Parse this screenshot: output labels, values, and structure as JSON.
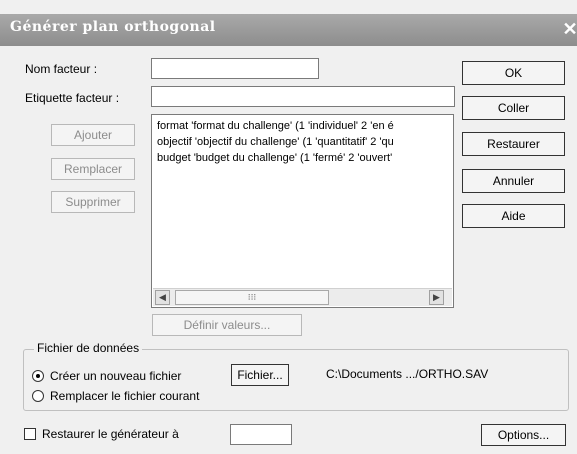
{
  "window": {
    "title": "Générer plan orthogonal",
    "close_glyph": "✕"
  },
  "labels": {
    "factor_name": "Nom facteur :",
    "factor_label": "Etiquette facteur :"
  },
  "inputs": {
    "factor_name_value": "",
    "factor_label_value": "",
    "restore_generator_value": ""
  },
  "side_buttons": {
    "add": "Ajouter",
    "replace": "Remplacer",
    "delete": "Supprimer"
  },
  "factors_list": [
    "format 'format du challenge' (1 'individuel' 2 'en é",
    "objectif 'objectif du challenge' (1 'quantitatif' 2 'qu",
    "budget 'budget du challenge' (1 'fermé' 2 'ouvert'"
  ],
  "scrollbar": {
    "left_arrow": "◀",
    "right_arrow": "▶",
    "thumb_grip": "⁝⁝⁝"
  },
  "define_values_button": "Définir valeurs...",
  "right_buttons": {
    "ok": "OK",
    "paste": "Coller",
    "restore": "Restaurer",
    "cancel": "Annuler",
    "help": "Aide"
  },
  "data_file": {
    "group_label": "Fichier de données",
    "create_new": "Créer un nouveau fichier",
    "replace_current": "Remplacer le fichier courant",
    "file_button": "Fichier...",
    "path": "C:\\Documents .../ORTHO.SAV",
    "selected": "create_new"
  },
  "restore_generator": {
    "label": "Restaurer le générateur à",
    "checked": false
  },
  "options_button": "Options..."
}
